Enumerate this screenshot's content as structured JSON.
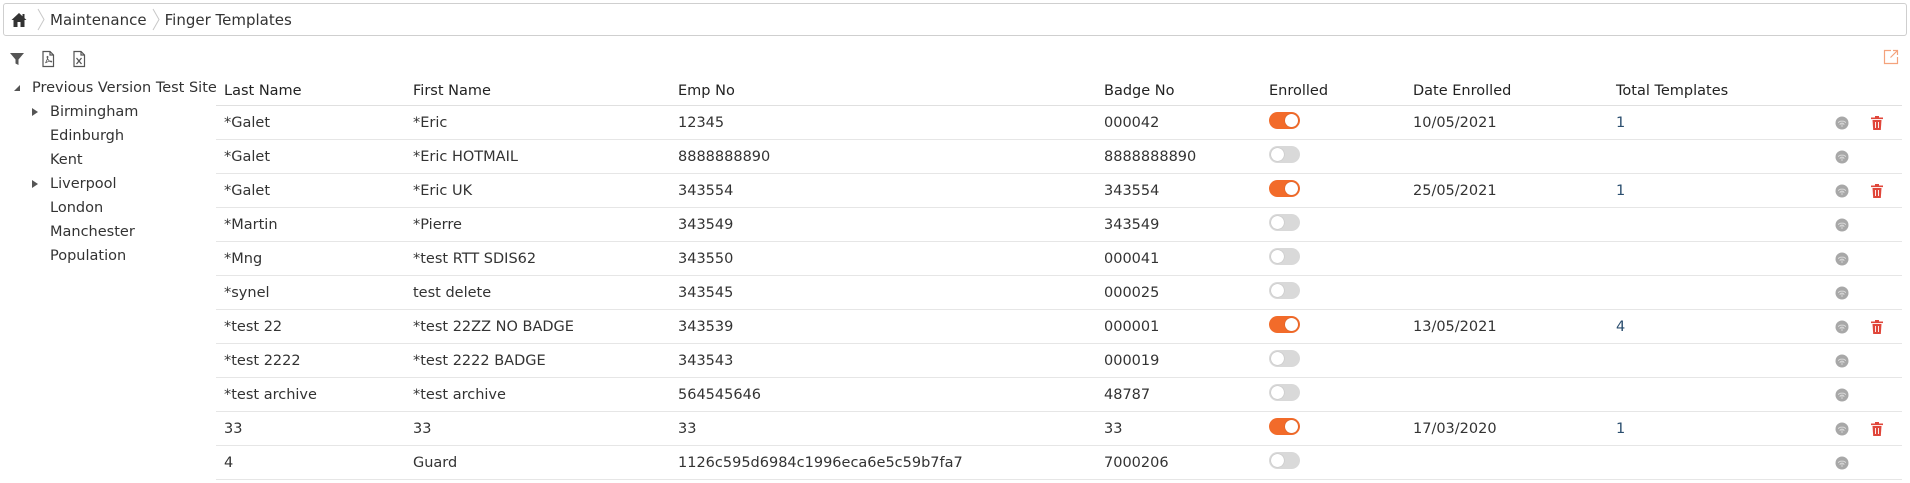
{
  "breadcrumb": {
    "items": [
      "Maintenance",
      "Finger Templates"
    ]
  },
  "toolbar": {
    "icons": [
      "filter-icon",
      "pdf-export-icon",
      "excel-export-icon"
    ]
  },
  "tree": {
    "root": "Previous Version Test Site",
    "children": [
      {
        "label": "Birmingham",
        "expandable": true
      },
      {
        "label": "Edinburgh",
        "expandable": false
      },
      {
        "label": "Kent",
        "expandable": false
      },
      {
        "label": "Liverpool",
        "expandable": true
      },
      {
        "label": "London",
        "expandable": false
      },
      {
        "label": "Manchester",
        "expandable": false
      },
      {
        "label": "Population",
        "expandable": false
      }
    ]
  },
  "table": {
    "headers": {
      "last_name": "Last Name",
      "first_name": "First Name",
      "emp_no": "Emp No",
      "badge_no": "Badge No",
      "enrolled": "Enrolled",
      "date_enrolled": "Date Enrolled",
      "total_templates": "Total Templates"
    },
    "rows": [
      {
        "last": "*Galet",
        "first": "*Eric",
        "emp": "12345",
        "badge": "000042",
        "enrolled": true,
        "date": "10/05/2021",
        "total": "1"
      },
      {
        "last": "*Galet",
        "first": "*Eric HOTMAIL",
        "emp": "8888888890",
        "badge": "8888888890",
        "enrolled": false,
        "date": "",
        "total": ""
      },
      {
        "last": "*Galet",
        "first": "*Eric UK",
        "emp": "343554",
        "badge": "343554",
        "enrolled": true,
        "date": "25/05/2021",
        "total": "1"
      },
      {
        "last": "*Martin",
        "first": "*Pierre",
        "emp": "343549",
        "badge": "343549",
        "enrolled": false,
        "date": "",
        "total": ""
      },
      {
        "last": "*Mng",
        "first": "*test RTT SDIS62",
        "emp": "343550",
        "badge": "000041",
        "enrolled": false,
        "date": "",
        "total": ""
      },
      {
        "last": "*synel",
        "first": "test delete",
        "emp": "343545",
        "badge": "000025",
        "enrolled": false,
        "date": "",
        "total": ""
      },
      {
        "last": "*test 22",
        "first": "*test 22ZZ NO BADGE",
        "emp": "343539",
        "badge": "000001",
        "enrolled": true,
        "date": "13/05/2021",
        "total": "4"
      },
      {
        "last": "*test 2222",
        "first": "*test 2222 BADGE",
        "emp": "343543",
        "badge": "000019",
        "enrolled": false,
        "date": "",
        "total": ""
      },
      {
        "last": "*test archive",
        "first": "*test archive",
        "emp": "564545646",
        "badge": "48787",
        "enrolled": false,
        "date": "",
        "total": ""
      },
      {
        "last": "33",
        "first": "33",
        "emp": "33",
        "badge": "33",
        "enrolled": true,
        "date": "17/03/2020",
        "total": "1"
      },
      {
        "last": "4",
        "first": "Guard",
        "emp": "1126c595d6984c1996eca6e5c59b7fa7",
        "badge": "7000206",
        "enrolled": false,
        "date": "",
        "total": ""
      }
    ]
  },
  "colors": {
    "toggle_on": "#f26b2a",
    "toggle_off": "#d9d9d9",
    "delete": "#e0463a",
    "fingerprint": "#a8a8a8"
  }
}
